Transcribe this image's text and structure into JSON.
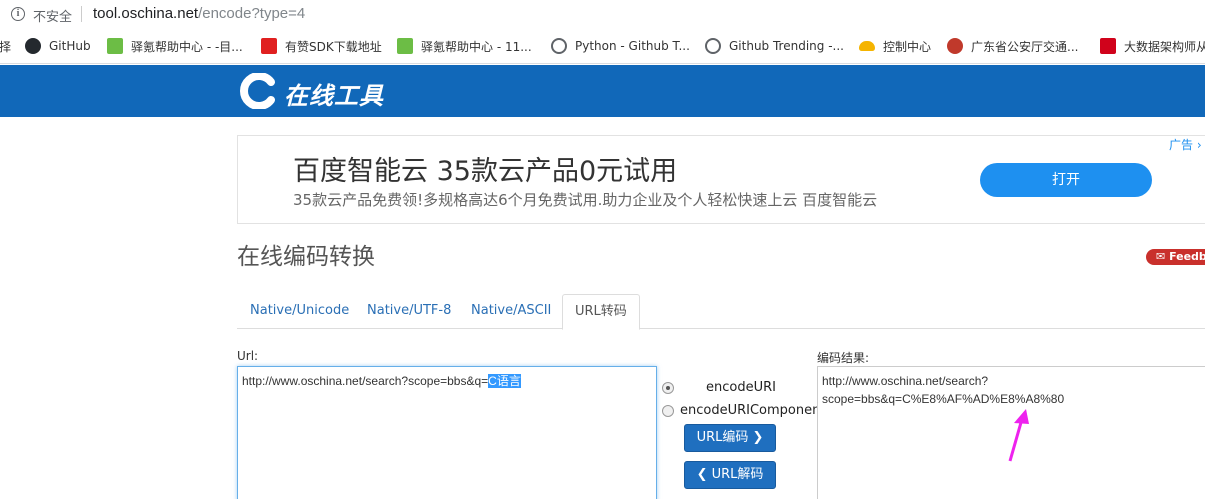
{
  "browser": {
    "security_label": "不安全",
    "url_host": "tool.oschina.net",
    "url_path": "/encode?type=4",
    "bookmarks": [
      {
        "label": "择",
        "icon": "cut-off-icon"
      },
      {
        "label": "GitHub",
        "icon": "github-icon"
      },
      {
        "label": "驿氪帮助中心 - -目...",
        "icon": "yikr-icon"
      },
      {
        "label": "有赞SDK下载地址",
        "icon": "youzan-icon"
      },
      {
        "label": "驿氪帮助中心 - 11...",
        "icon": "yikr-icon"
      },
      {
        "label": "Python - Github T...",
        "icon": "globe-icon"
      },
      {
        "label": "Github Trending -...",
        "icon": "globe-icon"
      },
      {
        "label": "控制中心",
        "icon": "cloud-icon"
      },
      {
        "label": "广东省公安厅交通...",
        "icon": "police-badge-icon"
      },
      {
        "label": "大数据架构师从",
        "icon": "csdn-icon"
      }
    ]
  },
  "site": {
    "logo_text": "在线工具"
  },
  "ad": {
    "title": "百度智能云 35款云产品0元试用",
    "description": "35款云产品免费领!多规格高达6个月免费试用.助力企业及个人轻松快速上云 百度智能云",
    "button": "打开",
    "tag": "广告"
  },
  "page": {
    "title": "在线编码转换",
    "feedback": "Feedb"
  },
  "tabs": [
    {
      "label": "Native/Unicode",
      "active": false
    },
    {
      "label": "Native/UTF-8",
      "active": false
    },
    {
      "label": "Native/ASCII",
      "active": false
    },
    {
      "label": "URL转码",
      "active": true
    }
  ],
  "form": {
    "url_label": "Url:",
    "url_value_plain": "http://www.oschina.net/search?scope=bbs&q=",
    "url_value_selected": "C语言",
    "result_label": "编码结果:",
    "result_value": "http://www.oschina.net/search?\nscope=bbs&q=C%E8%AF%AD%E8%A8%80",
    "radio_options": [
      {
        "label": "encodeURI",
        "checked": true
      },
      {
        "label": "encodeURIComponent",
        "checked": false
      }
    ],
    "encode_button": "URL编码",
    "decode_button": "URL解码"
  },
  "colors": {
    "header_blue": "#1168b9",
    "button_blue": "#1f6fbf",
    "ad_button": "#1e90f0",
    "annotation_arrow": "#ee22ee"
  }
}
